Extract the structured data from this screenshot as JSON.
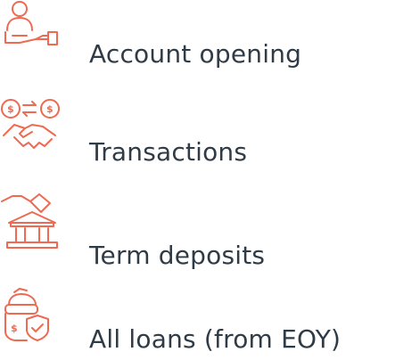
{
  "features": [
    {
      "icon": "account-user-hand-icon",
      "label": "Account opening"
    },
    {
      "icon": "exchange-handshake-icon",
      "label": "Transactions"
    },
    {
      "icon": "bank-deposit-icon",
      "label": "Term deposits"
    },
    {
      "icon": "loan-shield-icon",
      "label": "All loans (from EOY)"
    }
  ],
  "colors": {
    "accent": "#ee6a52",
    "text": "#2f3b46",
    "background": "#ffffff"
  }
}
